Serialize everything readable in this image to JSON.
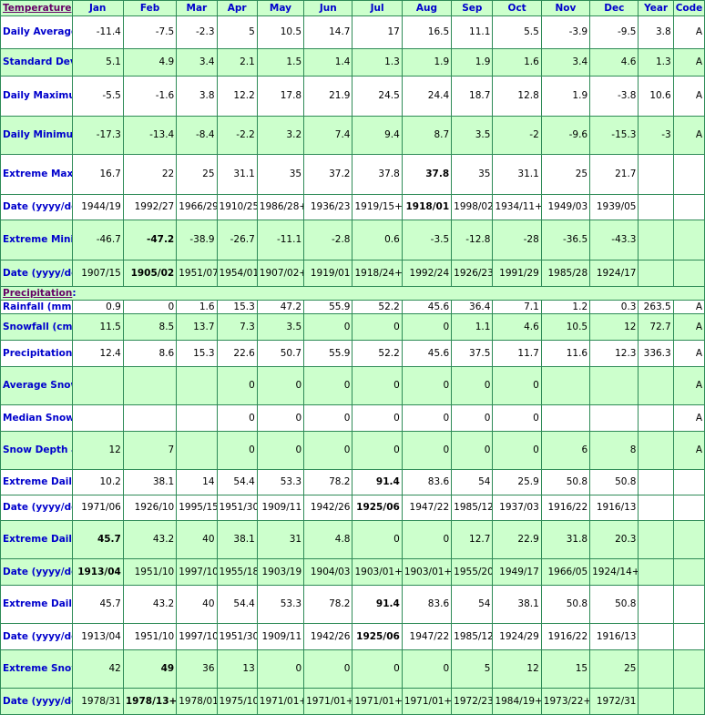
{
  "colors": {
    "border": "#2e8b57",
    "header_bg": "#ccffcc",
    "row_alt_bg": "#ccffcc",
    "label_text": "#0000cc",
    "section_text": "#660066"
  },
  "header": {
    "section_label": "Temperature",
    "colon": ":",
    "columns": [
      "Jan",
      "Feb",
      "Mar",
      "Apr",
      "May",
      "Jun",
      "Jul",
      "Aug",
      "Sep",
      "Oct",
      "Nov",
      "Dec",
      "Year",
      "Code"
    ]
  },
  "precip_section": {
    "label": "Precipitation",
    "colon": ":"
  },
  "rows": [
    {
      "label": "Daily Average (°C)",
      "shade": "w",
      "values": [
        "-11.4",
        "-7.5",
        "-2.3",
        "5",
        "10.5",
        "14.7",
        "17",
        "16.5",
        "11.1",
        "5.5",
        "-3.9",
        "-9.5",
        "3.8",
        "A"
      ],
      "bold": []
    },
    {
      "label": "Standard Deviation",
      "shade": "g",
      "values": [
        "5.1",
        "4.9",
        "3.4",
        "2.1",
        "1.5",
        "1.4",
        "1.3",
        "1.9",
        "1.9",
        "1.6",
        "3.4",
        "4.6",
        "1.3",
        "A"
      ],
      "bold": []
    },
    {
      "label": "Daily Maximum (°C)",
      "shade": "w",
      "values": [
        "-5.5",
        "-1.6",
        "3.8",
        "12.2",
        "17.8",
        "21.9",
        "24.5",
        "24.4",
        "18.7",
        "12.8",
        "1.9",
        "-3.8",
        "10.6",
        "A"
      ],
      "bold": []
    },
    {
      "label": "Daily Minimum (°C)",
      "shade": "g",
      "values": [
        "-17.3",
        "-13.4",
        "-8.4",
        "-2.2",
        "3.2",
        "7.4",
        "9.4",
        "8.7",
        "3.5",
        "-2",
        "-9.6",
        "-15.3",
        "-3",
        "A"
      ],
      "bold": []
    },
    {
      "label": "Extreme Maximum (°C)",
      "shade": "w",
      "sep": true,
      "values": [
        "16.7",
        "22",
        "25",
        "31.1",
        "35",
        "37.2",
        "37.8",
        "37.8",
        "35",
        "31.1",
        "25",
        "21.7",
        "",
        ""
      ],
      "bold": [
        7
      ]
    },
    {
      "label": "Date (yyyy/dd)",
      "shade": "w",
      "values": [
        "1944/19",
        "1992/27",
        "1966/29",
        "1910/25",
        "1986/28+",
        "1936/23",
        "1919/15+",
        "1918/01",
        "1998/02",
        "1934/11+",
        "1949/03",
        "1939/05",
        "",
        ""
      ],
      "bold": [
        7
      ]
    },
    {
      "label": "Extreme Minimum (°C)",
      "shade": "g",
      "values": [
        "-46.7",
        "-47.2",
        "-38.9",
        "-26.7",
        "-11.1",
        "-2.8",
        "0.6",
        "-3.5",
        "-12.8",
        "-28",
        "-36.5",
        "-43.3",
        "",
        ""
      ],
      "bold": [
        1
      ]
    },
    {
      "label": "Date (yyyy/dd)",
      "shade": "g",
      "values": [
        "1907/15",
        "1905/02",
        "1951/07",
        "1954/01",
        "1907/02+",
        "1919/01",
        "1918/24+",
        "1992/24",
        "1926/23",
        "1991/29",
        "1985/28",
        "1924/17",
        "",
        ""
      ],
      "bold": [
        1
      ]
    }
  ],
  "precip_rows": [
    {
      "label": "Rainfall (mm)",
      "shade": "w",
      "values": [
        "0.9",
        "0",
        "1.6",
        "15.3",
        "47.2",
        "55.9",
        "52.2",
        "45.6",
        "36.4",
        "7.1",
        "1.2",
        "0.3",
        "263.5",
        "A"
      ],
      "bold": []
    },
    {
      "label": "Snowfall (cm)",
      "shade": "g",
      "values": [
        "11.5",
        "8.5",
        "13.7",
        "7.3",
        "3.5",
        "0",
        "0",
        "0",
        "1.1",
        "4.6",
        "10.5",
        "12",
        "72.7",
        "A"
      ],
      "bold": []
    },
    {
      "label": "Precipitation (mm)",
      "shade": "w",
      "values": [
        "12.4",
        "8.6",
        "15.3",
        "22.6",
        "50.7",
        "55.9",
        "52.2",
        "45.6",
        "37.5",
        "11.7",
        "11.6",
        "12.3",
        "336.3",
        "A"
      ],
      "bold": []
    },
    {
      "label": "Average Snow Depth (cm)",
      "shade": "g",
      "values": [
        "",
        "",
        "",
        "0",
        "0",
        "0",
        "0",
        "0",
        "0",
        "0",
        "",
        "",
        "",
        "A"
      ],
      "bold": []
    },
    {
      "label": "Median Snow Depth (cm)",
      "shade": "w",
      "values": [
        "",
        "",
        "",
        "0",
        "0",
        "0",
        "0",
        "0",
        "0",
        "0",
        "",
        "",
        "",
        "A"
      ],
      "bold": []
    },
    {
      "label": "Snow Depth at Month-end (cm)",
      "shade": "g",
      "values": [
        "12",
        "7",
        "",
        "0",
        "0",
        "0",
        "0",
        "0",
        "0",
        "0",
        "6",
        "8",
        "",
        "A"
      ],
      "bold": []
    },
    {
      "label": "Extreme Daily Rainfall (mm)",
      "shade": "w",
      "sep": true,
      "values": [
        "10.2",
        "38.1",
        "14",
        "54.4",
        "53.3",
        "78.2",
        "91.4",
        "83.6",
        "54",
        "25.9",
        "50.8",
        "50.8",
        "",
        ""
      ],
      "bold": [
        6
      ]
    },
    {
      "label": "Date (yyyy/dd)",
      "shade": "w",
      "values": [
        "1971/06",
        "1926/10",
        "1995/15",
        "1951/30",
        "1909/11",
        "1942/26",
        "1925/06",
        "1947/22",
        "1985/12",
        "1937/03",
        "1916/22",
        "1916/13",
        "",
        ""
      ],
      "bold": [
        6
      ]
    },
    {
      "label": "Extreme Daily Snowfall (cm)",
      "shade": "g",
      "values": [
        "45.7",
        "43.2",
        "40",
        "38.1",
        "31",
        "4.8",
        "0",
        "0",
        "12.7",
        "22.9",
        "31.8",
        "20.3",
        "",
        ""
      ],
      "bold": [
        0
      ]
    },
    {
      "label": "Date (yyyy/dd)",
      "shade": "g",
      "values": [
        "1913/04",
        "1951/10",
        "1997/10",
        "1955/18",
        "1903/19",
        "1904/03",
        "1903/01+",
        "1903/01+",
        "1955/20",
        "1949/17",
        "1966/05",
        "1924/14+",
        "",
        ""
      ],
      "bold": [
        0
      ]
    },
    {
      "label": "Extreme Daily Precipitation (mm)",
      "shade": "w",
      "values": [
        "45.7",
        "43.2",
        "40",
        "54.4",
        "53.3",
        "78.2",
        "91.4",
        "83.6",
        "54",
        "38.1",
        "50.8",
        "50.8",
        "",
        ""
      ],
      "bold": [
        6
      ]
    },
    {
      "label": "Date (yyyy/dd)",
      "shade": "w",
      "values": [
        "1913/04",
        "1951/10",
        "1997/10",
        "1951/30",
        "1909/11",
        "1942/26",
        "1925/06",
        "1947/22",
        "1985/12",
        "1924/29",
        "1916/22",
        "1916/13",
        "",
        ""
      ],
      "bold": [
        6
      ]
    },
    {
      "label": "Extreme Snow Depth (cm)",
      "shade": "g",
      "values": [
        "42",
        "49",
        "36",
        "13",
        "0",
        "0",
        "0",
        "0",
        "5",
        "12",
        "15",
        "25",
        "",
        ""
      ],
      "bold": [
        1
      ]
    },
    {
      "label": "Date (yyyy/dd)",
      "shade": "g",
      "values": [
        "1978/31",
        "1978/13+",
        "1978/01",
        "1975/10",
        "1971/01+",
        "1971/01+",
        "1971/01+",
        "1971/01+",
        "1972/23",
        "1984/19+",
        "1973/22+",
        "1972/31",
        "",
        ""
      ],
      "bold": [
        1
      ]
    }
  ]
}
